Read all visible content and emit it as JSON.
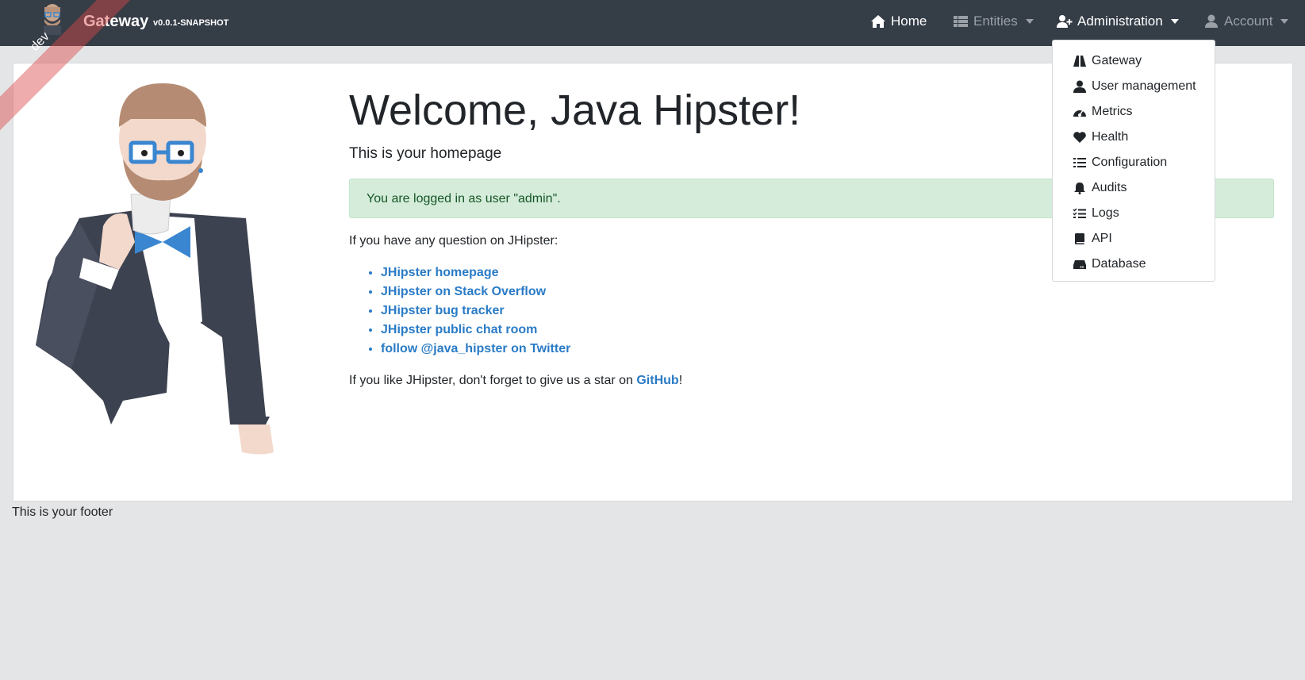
{
  "navbar": {
    "brand_title": "Gateway",
    "brand_version": "v0.0.1-SNAPSHOT",
    "ribbon": "dev",
    "home": "Home",
    "entities": "Entities",
    "administration": "Administration",
    "account": "Account"
  },
  "admin_menu": {
    "items": [
      {
        "label": "Gateway",
        "icon": "road-icon"
      },
      {
        "label": "User management",
        "icon": "user-icon"
      },
      {
        "label": "Metrics",
        "icon": "tachometer-icon"
      },
      {
        "label": "Health",
        "icon": "heart-icon"
      },
      {
        "label": "Configuration",
        "icon": "list-icon"
      },
      {
        "label": "Audits",
        "icon": "bell-icon"
      },
      {
        "label": "Logs",
        "icon": "tasks-icon"
      },
      {
        "label": "API",
        "icon": "book-icon"
      },
      {
        "label": "Database",
        "icon": "hdd-icon"
      }
    ]
  },
  "main": {
    "title": "Welcome, Java Hipster!",
    "subtitle": "This is your homepage",
    "alert": "You are logged in as user \"admin\".",
    "question": "If you have any question on JHipster:",
    "links": [
      "JHipster homepage",
      "JHipster on Stack Overflow",
      "JHipster bug tracker",
      "JHipster public chat room",
      "follow @java_hipster on Twitter"
    ],
    "star_prefix": "If you like JHipster, don't forget to give us a star on ",
    "star_link": "GitHub",
    "star_suffix": "!"
  },
  "footer": {
    "text": "This is your footer"
  },
  "colors": {
    "navbar": "#353d47",
    "link": "#2a7bc6",
    "alert_bg": "#d5ecdb",
    "page_bg": "#e4e5e6"
  }
}
